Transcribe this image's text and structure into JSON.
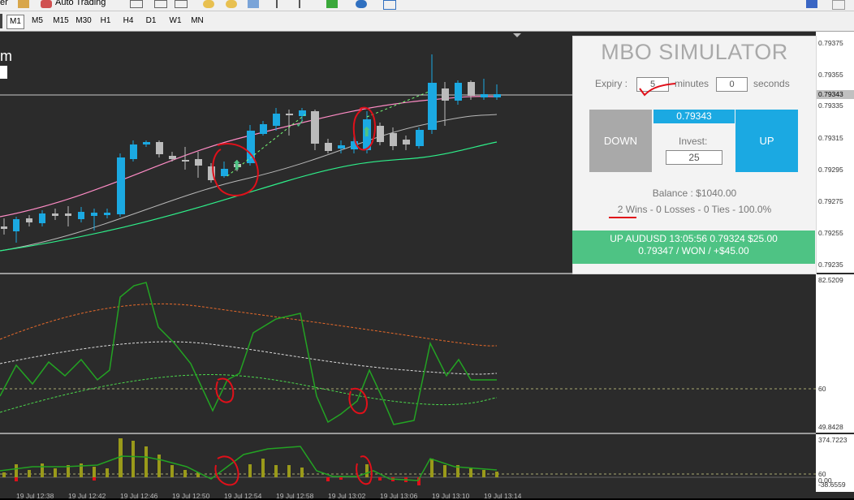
{
  "toolbar": {
    "fragment_left": "er",
    "auto_trading": "Auto Trading"
  },
  "timeframes": [
    "M1",
    "M5",
    "M15",
    "M30",
    "H1",
    "H4",
    "D1",
    "W1",
    "MN"
  ],
  "active_timeframe": "M1",
  "chart_title_fragment": "m",
  "price_axis": {
    "labels": [
      "0.79375",
      "0.79355",
      "0.79343",
      "0.79335",
      "0.79315",
      "0.79295",
      "0.79275",
      "0.79255",
      "0.79235"
    ],
    "current": "0.79343"
  },
  "indicator1_axis": {
    "top": "82.5209",
    "mid": "60",
    "bottom": "49.8428"
  },
  "indicator2_axis": {
    "top": "374.7223",
    "mid": "60",
    "mid2": "0.00",
    "bottom": "-38.6559"
  },
  "time_labels": [
    "19 Jul 12:38",
    "19 Jul 12:42",
    "19 Jul 12:46",
    "19 Jul 12:50",
    "19 Jul 12:54",
    "19 Jul 12:58",
    "19 Jul 13:02",
    "19 Jul 13:06",
    "19 Jul 13:10",
    "19 Jul 13:14"
  ],
  "simulator": {
    "title": "MBO SIMULATOR",
    "expiry_label": "Expiry :",
    "expiry_minutes": "5",
    "minutes_label": "minutes",
    "expiry_seconds": "0",
    "seconds_label": "seconds",
    "down_label": "DOWN",
    "up_label": "UP",
    "price": "0.79343",
    "invest_label": "Invest:",
    "invest_value": "25",
    "balance": "Balance : $1040.00",
    "stats": "2 Wins - 0 Losses - 0 Ties - 100.0%",
    "result_line1": "UP AUDUSD 13:05:56 0.79324 $25.00",
    "result_line2": "0.79347 / WON / +$45.00"
  },
  "colors": {
    "background": "#2b2b2b",
    "up_candle": "#1ba9e2",
    "down_candle": "#c0c0c0",
    "upper_band": "#ff8cc6",
    "lower_band": "#2ef08a",
    "annotation": "#e0101a",
    "win_banner": "#4ec384"
  }
}
